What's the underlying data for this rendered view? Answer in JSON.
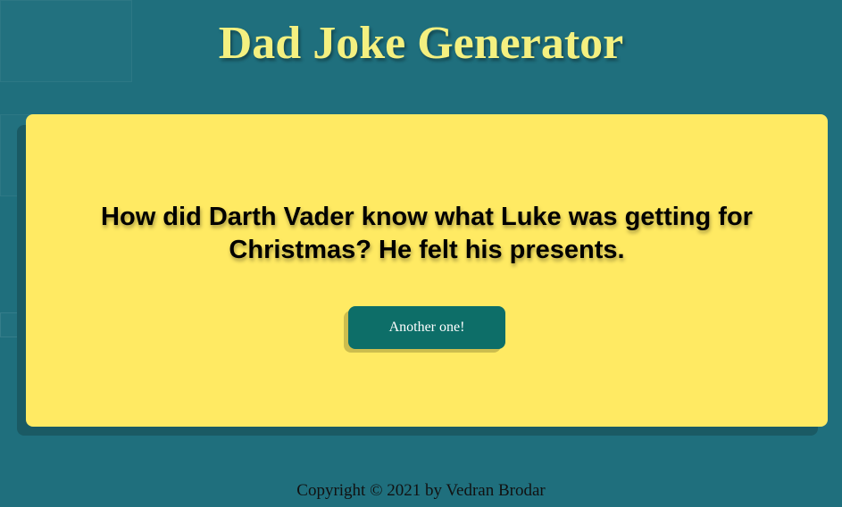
{
  "header": {
    "title": "Dad Joke Generator"
  },
  "joke_card": {
    "joke_text": "How did Darth Vader know what Luke was getting for Christmas? He felt his presents.",
    "button_label": "Another one!"
  },
  "footer": {
    "copyright": "Copyright © 2021 by Vedran Brodar"
  },
  "colors": {
    "background": "#1f6f7d",
    "title": "#f4f080",
    "card": "#ffea63",
    "button": "#0d6e68"
  }
}
